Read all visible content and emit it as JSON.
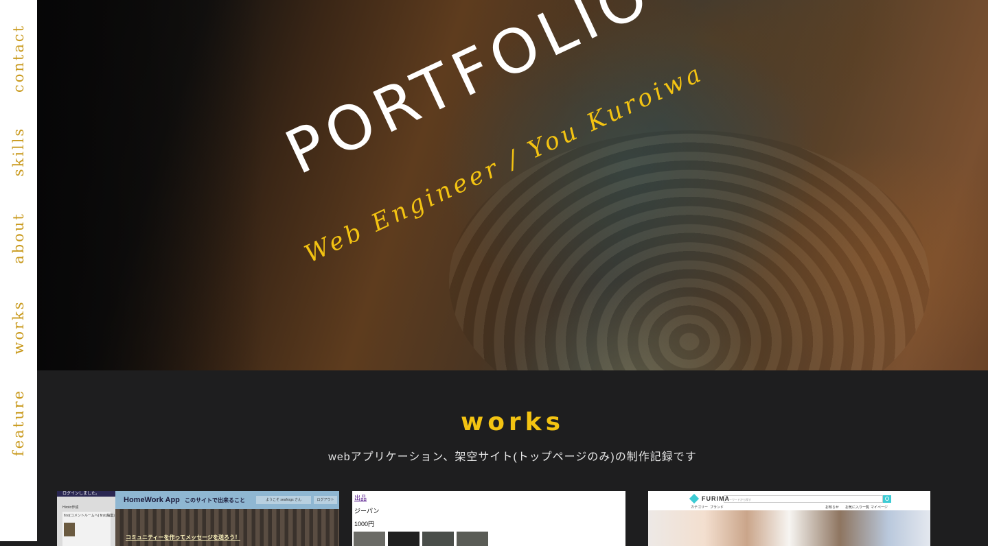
{
  "sidenav": {
    "items": [
      "contact",
      "skills",
      "about",
      "works",
      "feature"
    ],
    "color": "#c99a1e"
  },
  "hero": {
    "title": "PORTFOLIO",
    "subtitle": "Web Engineer / You Kuroiwa",
    "title_color": "#ffffff",
    "subtitle_color": "#f3c312"
  },
  "works": {
    "heading": "works",
    "description": "webアプリケーション、架空サイト(トップページのみ)の制作記録です",
    "heading_color": "#f3c312",
    "cards": [
      {
        "login_notice": "ログインしました。",
        "sidebar_label": "Hiroto作成",
        "sidebar_item": "first(コメントルームへ) first(編集)",
        "app_name": "HomeWork App",
        "feature_link": "このサイトで出来ること",
        "welcome": "ようこそ seafrogs さん",
        "logout": "ログアウト",
        "cta": "コミュニティーを作ってメッセージを送ろう！"
      },
      {
        "exhibit_link": "出品",
        "item_name": "ジーパン",
        "price": "1000円"
      },
      {
        "logo": "FURIMA",
        "search_placeholder": "キーワードから探す",
        "nav_category": "カテゴリー",
        "nav_brand": "ブランド",
        "nav_notice": "お知らせ",
        "nav_favorites": "お気に入り一覧",
        "nav_mypage": "マイページ"
      }
    ]
  }
}
